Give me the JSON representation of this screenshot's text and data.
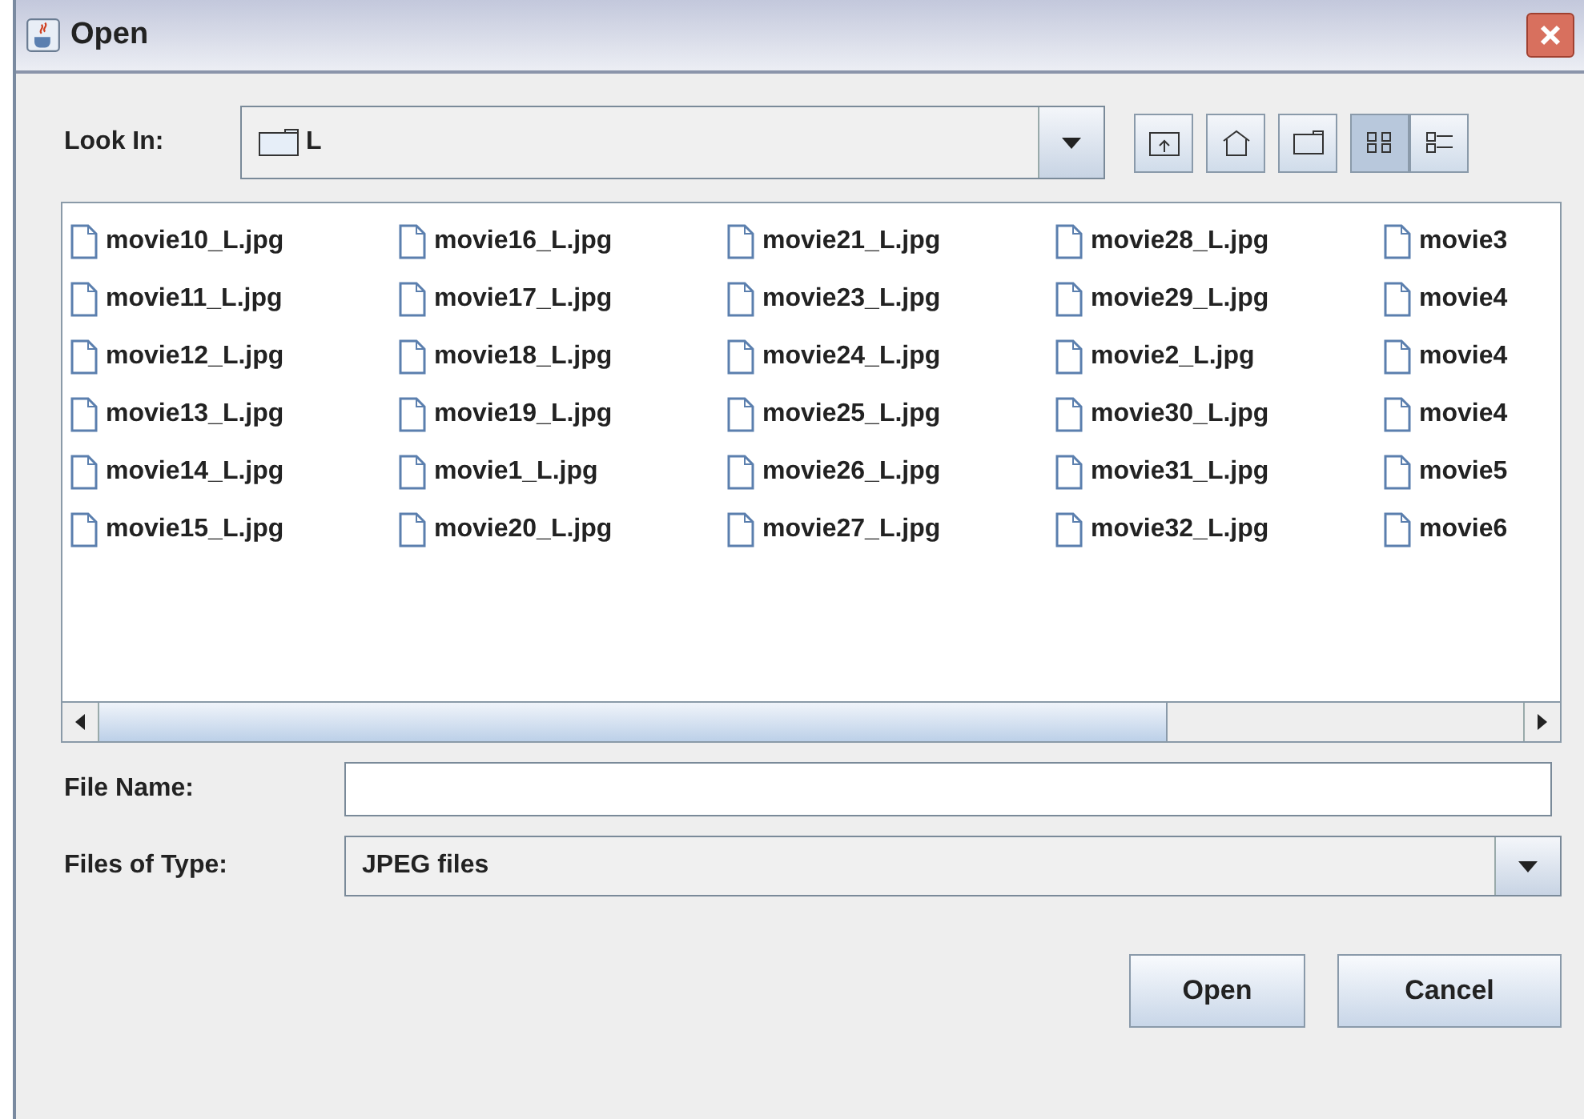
{
  "window": {
    "title": "Open"
  },
  "look_in": {
    "label": "Look In:",
    "value": "L"
  },
  "toolbar": {
    "views": [
      {
        "kind": "list",
        "selected": true
      },
      {
        "kind": "details",
        "selected": false
      }
    ]
  },
  "file_columns": [
    [
      "movie10_L.jpg",
      "movie11_L.jpg",
      "movie12_L.jpg",
      "movie13_L.jpg",
      "movie14_L.jpg",
      "movie15_L.jpg"
    ],
    [
      "movie16_L.jpg",
      "movie17_L.jpg",
      "movie18_L.jpg",
      "movie19_L.jpg",
      "movie1_L.jpg",
      "movie20_L.jpg"
    ],
    [
      "movie21_L.jpg",
      "movie23_L.jpg",
      "movie24_L.jpg",
      "movie25_L.jpg",
      "movie26_L.jpg",
      "movie27_L.jpg"
    ],
    [
      "movie28_L.jpg",
      "movie29_L.jpg",
      "movie2_L.jpg",
      "movie30_L.jpg",
      "movie31_L.jpg",
      "movie32_L.jpg"
    ],
    [
      "movie3",
      "movie4",
      "movie4",
      "movie4",
      "movie5",
      "movie6"
    ]
  ],
  "file_name": {
    "label": "File Name:"
  },
  "file_type": {
    "label": "Files of Type:",
    "value": "JPEG files"
  },
  "buttons": [
    "Open",
    "Cancel"
  ]
}
